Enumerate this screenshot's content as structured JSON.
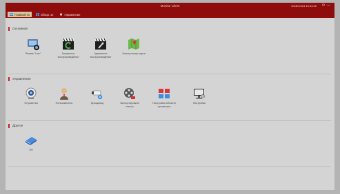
{
  "window": {
    "title": "Monitor Client",
    "datetime": "2018/10/24 10:33:40"
  },
  "tabs": [
    {
      "label": "Главный эк",
      "icon": "home-icon"
    },
    {
      "label": "Обзор. эк",
      "icon": "monitor-view-icon"
    },
    {
      "label": "Управление",
      "icon": "gear-icon"
    }
  ],
  "sections": {
    "main": {
      "title": "Основной",
      "items": [
        {
          "label": "Режим \"Live\"",
          "icon": "live-camera-icon"
        },
        {
          "label": "Локальное воспроизведение",
          "icon": "local-playback-icon"
        },
        {
          "label": "Удаленное воспроизведение",
          "icon": "remote-playback-icon"
        },
        {
          "label": "Электронная карта",
          "icon": "emap-icon"
        }
      ]
    },
    "manage": {
      "title": "Управление",
      "items": [
        {
          "label": "Устройство",
          "icon": "device-icon"
        },
        {
          "label": "Пользователь",
          "icon": "user-icon"
        },
        {
          "label": "Вращающ",
          "icon": "ptz-camera-icon"
        },
        {
          "label": "Экспортировать список",
          "icon": "export-list-icon"
        },
        {
          "label": "Настройка области просмотра",
          "icon": "view-layout-icon"
        },
        {
          "label": "Настройки",
          "icon": "settings-monitor-icon"
        }
      ]
    },
    "other": {
      "title": "Другое",
      "items": [
        {
          "label": "Об",
          "icon": "about-book-icon"
        }
      ]
    }
  },
  "colors": {
    "titlebar": "#8f0c0c",
    "active_tab": "#d6c49a",
    "section_marker": "#c0202a",
    "background": "#d4d4d4"
  }
}
